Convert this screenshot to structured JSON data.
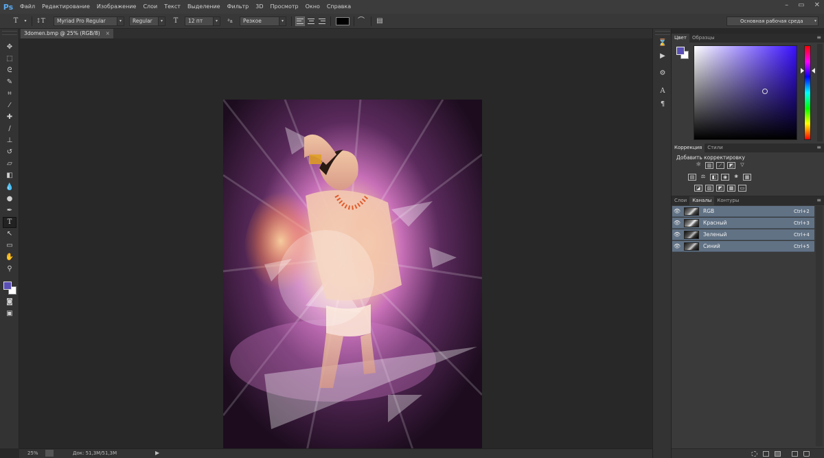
{
  "app": {
    "logo": "Ps"
  },
  "menu": [
    "Файл",
    "Редактирование",
    "Изображение",
    "Слои",
    "Текст",
    "Выделение",
    "Фильтр",
    "3D",
    "Просмотр",
    "Окно",
    "Справка"
  ],
  "window_controls": {
    "minimize": "–",
    "restore": "▭",
    "close": "✕"
  },
  "options": {
    "font_family": "Myriad Pro Regular",
    "font_style": "Regular",
    "font_size": "12 пт",
    "antialias": "Резкое",
    "color": "#000000"
  },
  "workspace": "Основная рабочая среда",
  "document": {
    "tab_title": "3domen.bmp @ 25% (RGB/8)",
    "close": "×"
  },
  "status": {
    "zoom": "25%",
    "doc_info": "Док: 51,3M/51,3M",
    "arrow": "▶"
  },
  "colors": {
    "foreground": "#5a4fb4",
    "background": "#ffffff",
    "accent_selected": "#617285"
  },
  "color_panel": {
    "tabs": [
      "Цвет",
      "Образцы"
    ],
    "active_tab": 0
  },
  "adjustments_panel": {
    "tabs": [
      "Коррекция",
      "Стили"
    ],
    "title": "Добавить корректировку"
  },
  "channels_panel": {
    "tabs": [
      "Слои",
      "Каналы",
      "Контуры"
    ],
    "active_tab": 1,
    "channels": [
      {
        "name": "RGB",
        "shortcut": "Ctrl+2"
      },
      {
        "name": "Красный",
        "shortcut": "Ctrl+3"
      },
      {
        "name": "Зеленый",
        "shortcut": "Ctrl+4"
      },
      {
        "name": "Синий",
        "shortcut": "Ctrl+5"
      }
    ]
  },
  "tools": [
    "move-tool",
    "marquee-tool",
    "lasso-tool",
    "quick-selection-tool",
    "crop-tool",
    "eyedropper-tool",
    "spot-healing-tool",
    "brush-tool",
    "clone-stamp-tool",
    "history-brush-tool",
    "eraser-tool",
    "gradient-tool",
    "blur-tool",
    "dodge-tool",
    "pen-tool",
    "type-tool",
    "path-selection-tool",
    "rectangle-tool",
    "hand-tool",
    "zoom-tool"
  ]
}
